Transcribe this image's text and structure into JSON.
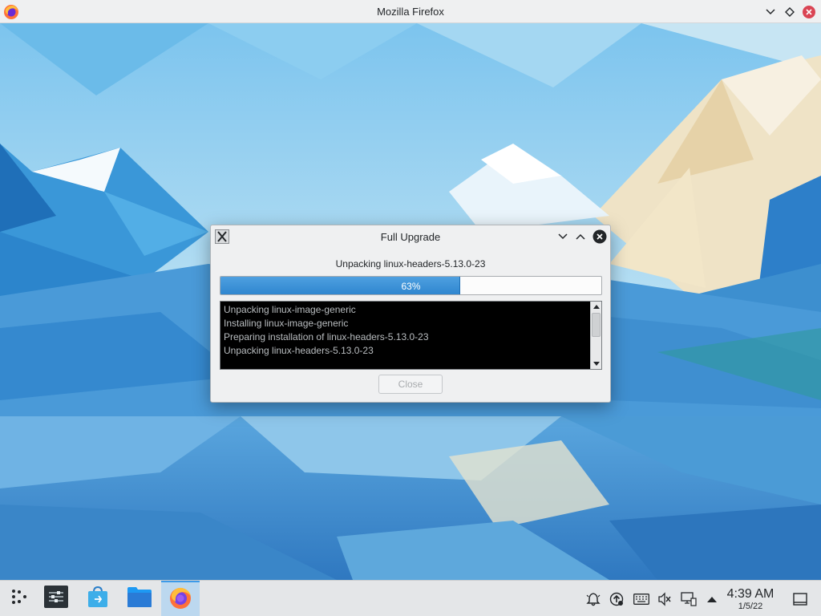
{
  "window": {
    "title": "Mozilla Firefox"
  },
  "dialog": {
    "title": "Full Upgrade",
    "status": "Unpacking linux-headers-5.13.0-23",
    "progress_percent": 63,
    "progress_label": "63%",
    "log_lines": [
      "Unpacking linux-image-generic",
      "Installing linux-image-generic",
      "Preparing installation of linux-headers-5.13.0-23",
      "Unpacking linux-headers-5.13.0-23"
    ],
    "close_label": "Close",
    "close_enabled": false
  },
  "taskbar": {
    "items": [
      {
        "name": "application-launcher",
        "icon": "launcher-icon"
      },
      {
        "name": "system-settings",
        "icon": "settings-sliders-icon"
      },
      {
        "name": "discover",
        "icon": "store-bag-icon"
      },
      {
        "name": "dolphin",
        "icon": "folder-icon"
      },
      {
        "name": "firefox",
        "icon": "firefox-icon",
        "active": true
      }
    ],
    "tray": [
      "notifications-icon",
      "update-icon",
      "keyboard-icon",
      "volume-muted-icon",
      "network-icon",
      "expand-tray-icon"
    ],
    "clock": {
      "time": "4:39 AM",
      "date": "1/5/22"
    }
  },
  "colors": {
    "accent": "#3d9ae8",
    "progress_fill": "#2f86cf",
    "log_background": "#000000",
    "log_text": "#b8bcbf"
  }
}
